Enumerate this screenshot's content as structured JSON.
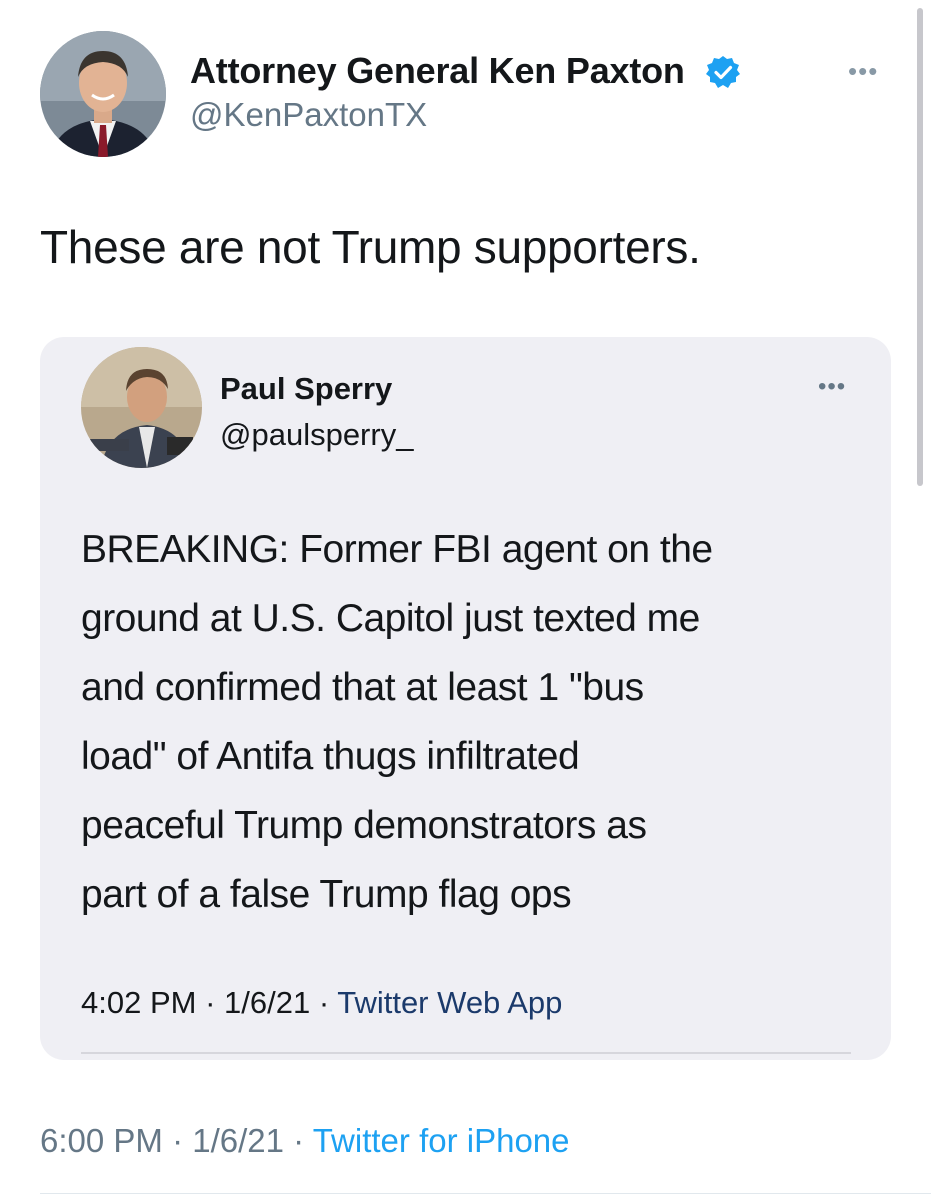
{
  "tweet": {
    "author": {
      "display_name": "Attorney General Ken Paxton",
      "handle": "@KenPaxtonTX",
      "verified": true
    },
    "more_icon": "more-horizontal-icon",
    "text": "These are not Trump supporters.",
    "time": "6:00 PM",
    "date": "1/6/21",
    "separator": " · ",
    "source": "Twitter for iPhone"
  },
  "quoted_tweet": {
    "author": {
      "display_name": "Paul Sperry",
      "handle": "@paulsperry_"
    },
    "more_icon": "more-horizontal-icon",
    "text_lines": [
      "BREAKING: Former FBI agent on the",
      "ground at U.S. Capitol just texted me",
      "and confirmed that at least 1 \"bus",
      "load\" of Antifa thugs infiltrated",
      "peaceful Trump demonstrators as",
      "part of a false Trump flag ops"
    ],
    "time": "4:02 PM",
    "date": "1/6/21",
    "separator": " · ",
    "source": "Twitter Web App"
  },
  "colors": {
    "text_primary": "#14171a",
    "text_secondary": "#657786",
    "link_blue": "#1da1f2",
    "verified_blue": "#1da1f2",
    "quote_background": "#efeff4"
  }
}
